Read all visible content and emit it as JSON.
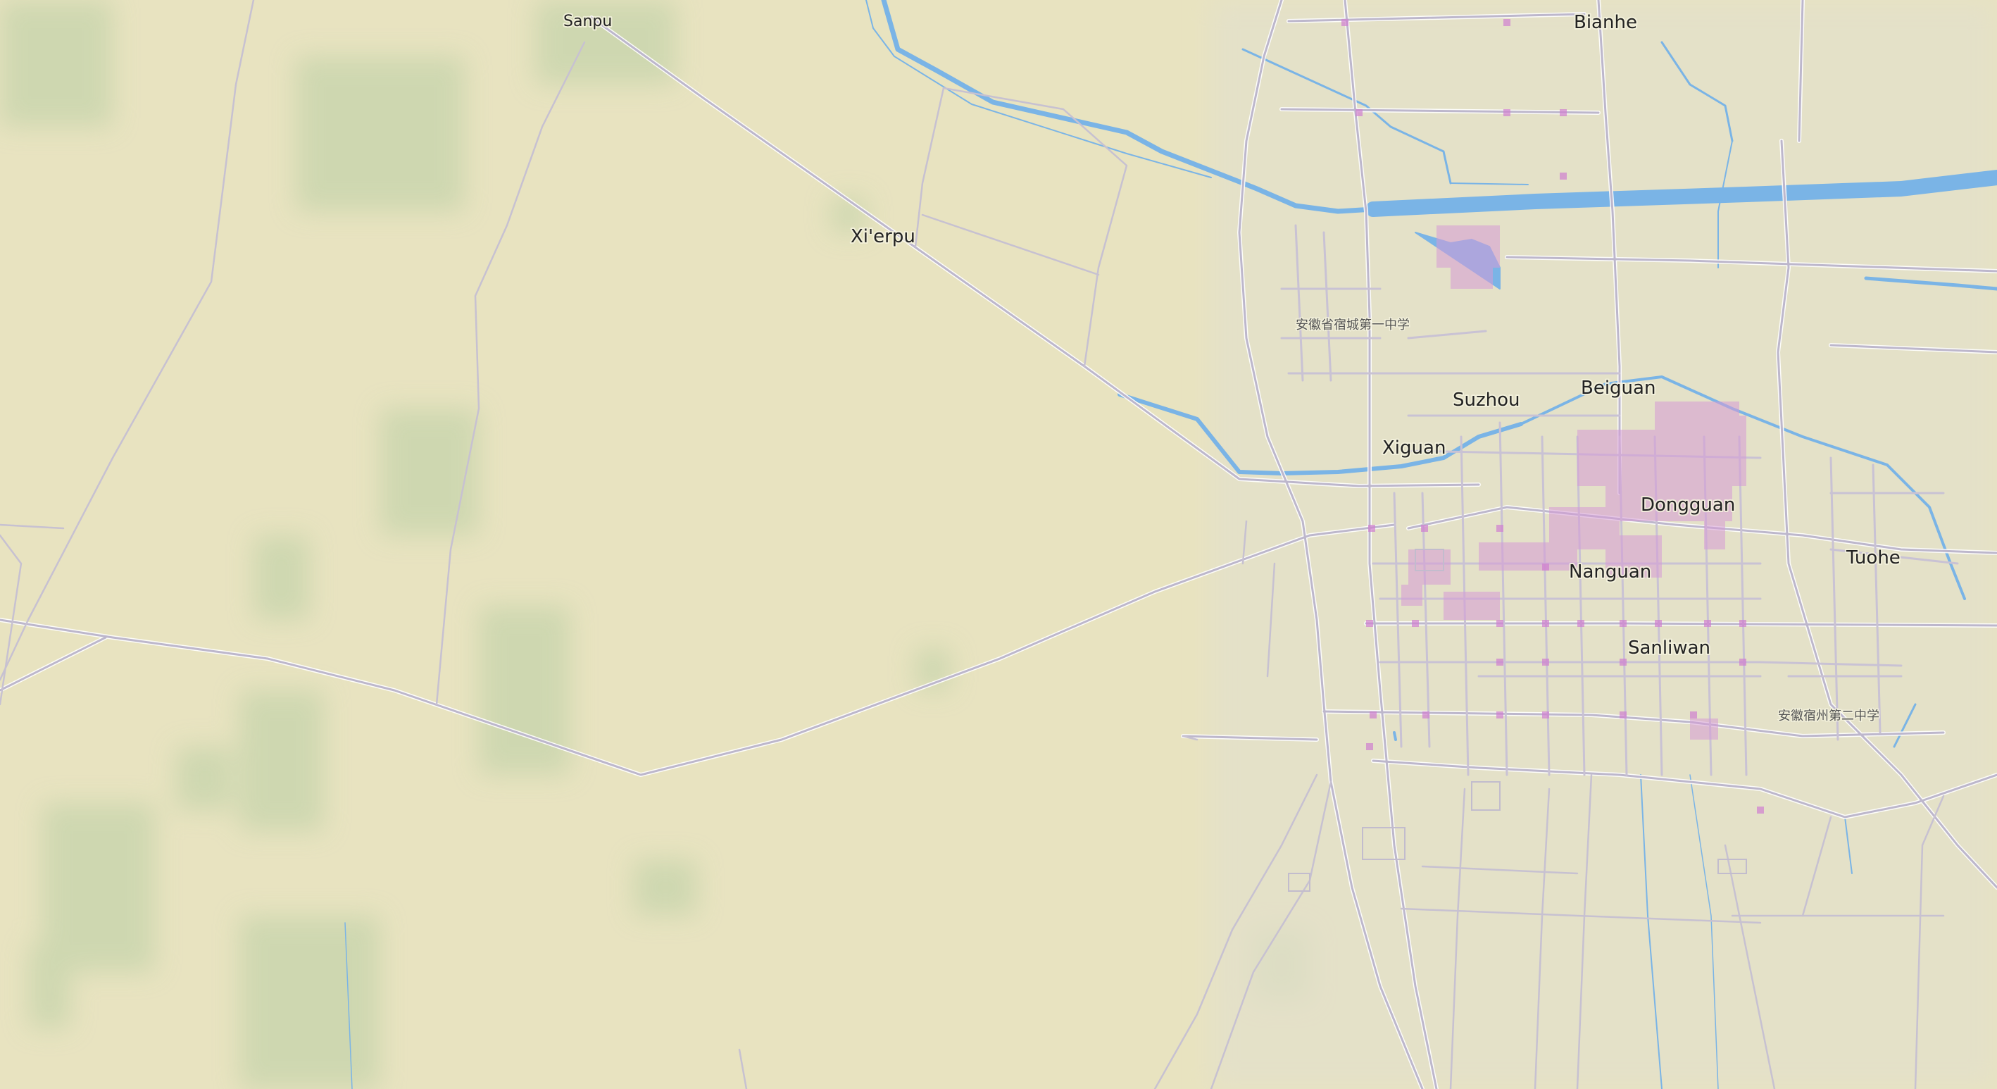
{
  "map": {
    "colors": {
      "land": "#e8e3c0",
      "vegetation": "#cbd9b3",
      "urban": "#e2ddc8",
      "water": "#7ab4e6",
      "road": "#b9b4c8",
      "road_casing": "#ffffff",
      "builtup": "#d69bd6"
    },
    "places": [
      {
        "name": "Sanpu",
        "size": "small"
      },
      {
        "name": "Xi'erpu",
        "size": "medium"
      },
      {
        "name": "Bianhe",
        "size": "medium"
      },
      {
        "name": "Suzhou",
        "size": "medium"
      },
      {
        "name": "Beiguan",
        "size": "medium"
      },
      {
        "name": "Xiguan",
        "size": "medium"
      },
      {
        "name": "Dongguan",
        "size": "medium"
      },
      {
        "name": "Nanguan",
        "size": "medium"
      },
      {
        "name": "Tuohe",
        "size": "medium"
      },
      {
        "name": "Sanliwan",
        "size": "medium"
      }
    ],
    "pois": [
      {
        "name": "安徽省宿城第一中学"
      },
      {
        "name": "安徽宿州第二中学"
      }
    ]
  }
}
